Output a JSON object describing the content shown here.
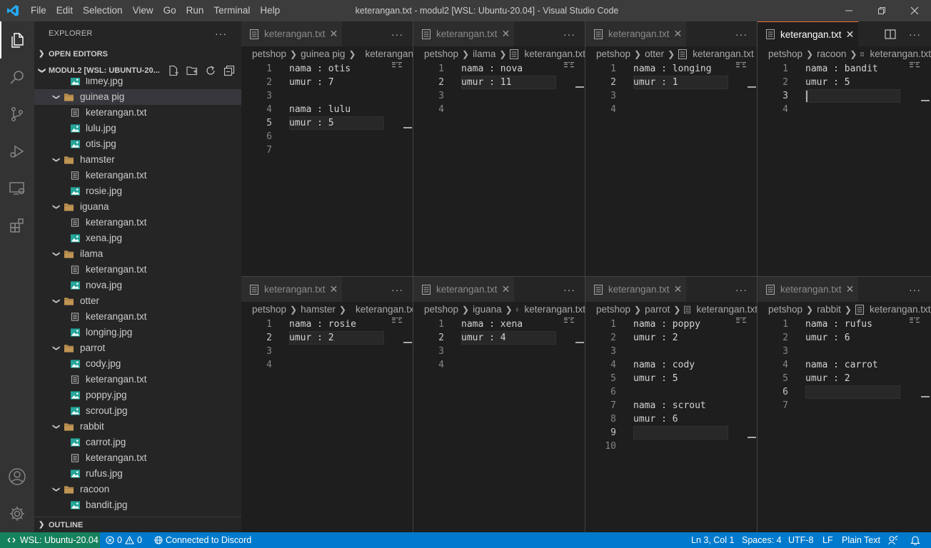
{
  "window": {
    "title": "keterangan.txt - modul2 [WSL: Ubuntu-20.04] - Visual Studio Code",
    "menu": [
      "File",
      "Edit",
      "Selection",
      "View",
      "Go",
      "Run",
      "Terminal",
      "Help"
    ]
  },
  "sidebar": {
    "title": "EXPLORER",
    "open_editors": "OPEN EDITORS",
    "workspace": "MODUL2 [WSL: UBUNTU-20...",
    "outline": "OUTLINE",
    "tree": [
      {
        "type": "file",
        "kind": "image",
        "label": "limey.jpg"
      },
      {
        "type": "folder",
        "label": "guinea pig"
      },
      {
        "type": "file",
        "kind": "text",
        "label": "keterangan.txt"
      },
      {
        "type": "file",
        "kind": "image",
        "label": "lulu.jpg"
      },
      {
        "type": "file",
        "kind": "image",
        "label": "otis.jpg"
      },
      {
        "type": "folder",
        "label": "hamster"
      },
      {
        "type": "file",
        "kind": "text",
        "label": "keterangan.txt"
      },
      {
        "type": "file",
        "kind": "image",
        "label": "rosie.jpg"
      },
      {
        "type": "folder",
        "label": "iguana"
      },
      {
        "type": "file",
        "kind": "text",
        "label": "keterangan.txt"
      },
      {
        "type": "file",
        "kind": "image",
        "label": "xena.jpg"
      },
      {
        "type": "folder",
        "label": "ilama"
      },
      {
        "type": "file",
        "kind": "text",
        "label": "keterangan.txt"
      },
      {
        "type": "file",
        "kind": "image",
        "label": "nova.jpg"
      },
      {
        "type": "folder",
        "label": "otter"
      },
      {
        "type": "file",
        "kind": "text",
        "label": "keterangan.txt"
      },
      {
        "type": "file",
        "kind": "image",
        "label": "longing.jpg"
      },
      {
        "type": "folder",
        "label": "parrot"
      },
      {
        "type": "file",
        "kind": "image",
        "label": "cody.jpg"
      },
      {
        "type": "file",
        "kind": "text",
        "label": "keterangan.txt"
      },
      {
        "type": "file",
        "kind": "image",
        "label": "poppy.jpg"
      },
      {
        "type": "file",
        "kind": "image",
        "label": "scrout.jpg"
      },
      {
        "type": "folder",
        "label": "rabbit"
      },
      {
        "type": "file",
        "kind": "image",
        "label": "carrot.jpg"
      },
      {
        "type": "file",
        "kind": "text",
        "label": "keterangan.txt"
      },
      {
        "type": "file",
        "kind": "image",
        "label": "rufus.jpg"
      },
      {
        "type": "folder",
        "label": "racoon"
      },
      {
        "type": "file",
        "kind": "image",
        "label": "bandit.jpg"
      }
    ]
  },
  "editors": [
    {
      "tab": "keterangan.txt",
      "breadcrumb": [
        "petshop",
        "guinea pig",
        "keterangan.txt"
      ],
      "current_line": 5,
      "lines": [
        "nama : otis",
        "umur : 7",
        "",
        "nama : lulu",
        "umur : 5",
        "",
        ""
      ]
    },
    {
      "tab": "keterangan.txt",
      "breadcrumb": [
        "petshop",
        "ilama",
        "keterangan.txt"
      ],
      "current_line": 2,
      "lines": [
        "nama : nova",
        "umur : 11",
        "",
        ""
      ]
    },
    {
      "tab": "keterangan.txt",
      "breadcrumb": [
        "petshop",
        "otter",
        "keterangan.txt"
      ],
      "current_line": 2,
      "lines": [
        "nama : longing",
        "umur : 1",
        "",
        ""
      ]
    },
    {
      "tab": "keterangan.txt",
      "breadcrumb": [
        "petshop",
        "racoon",
        "keterangan.txt"
      ],
      "current_line": 3,
      "focused": true,
      "lines": [
        "nama : bandit",
        "umur : 5",
        "",
        ""
      ]
    },
    {
      "tab": "keterangan.txt",
      "breadcrumb": [
        "petshop",
        "hamster",
        "keterangan.txt"
      ],
      "current_line": 2,
      "lines": [
        "nama : rosie",
        "umur : 2",
        "",
        ""
      ]
    },
    {
      "tab": "keterangan.txt",
      "breadcrumb": [
        "petshop",
        "iguana",
        "keterangan.txt"
      ],
      "current_line": 2,
      "lines": [
        "nama : xena",
        "umur : 4",
        "",
        ""
      ]
    },
    {
      "tab": "keterangan.txt",
      "breadcrumb": [
        "petshop",
        "parrot",
        "keterangan.txt"
      ],
      "current_line": 9,
      "lines": [
        "nama : poppy",
        "umur : 2",
        "",
        "nama : cody",
        "umur : 5",
        "",
        "nama : scrout",
        "umur : 6",
        "",
        ""
      ]
    },
    {
      "tab": "keterangan.txt",
      "breadcrumb": [
        "petshop",
        "rabbit",
        "keterangan.txt"
      ],
      "current_line": 6,
      "lines": [
        "nama : rufus",
        "umur : 6",
        "",
        "nama : carrot",
        "umur : 2",
        "",
        ""
      ]
    }
  ],
  "statusbar": {
    "remote": "WSL: Ubuntu-20.04",
    "errors": "0",
    "warnings": "0",
    "discord": "Connected to Discord",
    "position": "Ln 3, Col 1",
    "spaces": "Spaces: 4",
    "encoding": "UTF-8",
    "eol": "LF",
    "language": "Plain Text"
  },
  "colors": {
    "accent_tab": "#e7733a",
    "statusbar": "#007acc",
    "remote": "#16825d",
    "folder": "#c09553",
    "image_icon": "#26a69a"
  }
}
